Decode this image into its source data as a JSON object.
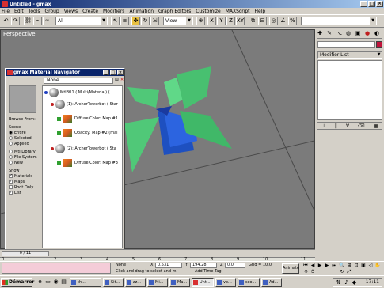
{
  "window": {
    "title": "Untitled - gmax"
  },
  "menu": [
    "File",
    "Edit",
    "Tools",
    "Group",
    "Views",
    "Create",
    "Modifiers",
    "Animation",
    "Graph Editors",
    "Customize",
    "MAXScript",
    "Help"
  ],
  "toolbar": {
    "select_filter": "All",
    "ref_coord": "View",
    "named_sel": ""
  },
  "viewport": {
    "label": "Perspective"
  },
  "command_panel": {
    "modifier_list": "Modifier List"
  },
  "material_navigator": {
    "title": "gmax Material Navigator",
    "none_label": "None",
    "browse_from_label": "Browse From:",
    "scene_label": "Scene",
    "browse_options": [
      "Entire",
      "Selected",
      "Applied"
    ],
    "library_options": [
      "Mtl Library",
      "File System",
      "New"
    ],
    "show_label": "Show",
    "show_options": [
      "Materials",
      "Maps",
      "Root Only",
      "List"
    ],
    "tree": [
      "MtlBtl1 ( Multi/Materia ) (",
      "(1): ArcherTowerbot ( Star",
      "Diffuse Color: Map #1",
      "Opacity: Map #2 (mal_",
      "(2): ArcherTowerbot ( Sta",
      "Diffuse Color: Map #3"
    ]
  },
  "trackbar": {
    "frame": "0 / 11",
    "ticks": [
      "0",
      "1",
      "2",
      "3",
      "4",
      "5",
      "6",
      "7",
      "8",
      "9",
      "10",
      "11"
    ]
  },
  "status": {
    "selection": "None",
    "x_label": "X",
    "x_value": "0.531",
    "y_label": "Y",
    "y_value": "194.28",
    "z_label": "Z",
    "z_value": "0.0",
    "grid": "Grid = 10.0",
    "prompt": "Click and drag to select and m",
    "add_time_tag": "Add Time Tag",
    "animate": "Animate"
  },
  "taskbar": {
    "start": "Démarrer",
    "buttons": [
      "th...",
      "Sit...",
      "zz...",
      "Mi...",
      "Ma...",
      "Unt...",
      "ve...",
      "sco...",
      "Ad..."
    ],
    "clock": "17:11"
  },
  "colors": {
    "title_start": "#0a246a",
    "title_end": "#a6caf0",
    "mesh_green": "#50c878",
    "mesh_blue": "#1e50c0"
  }
}
